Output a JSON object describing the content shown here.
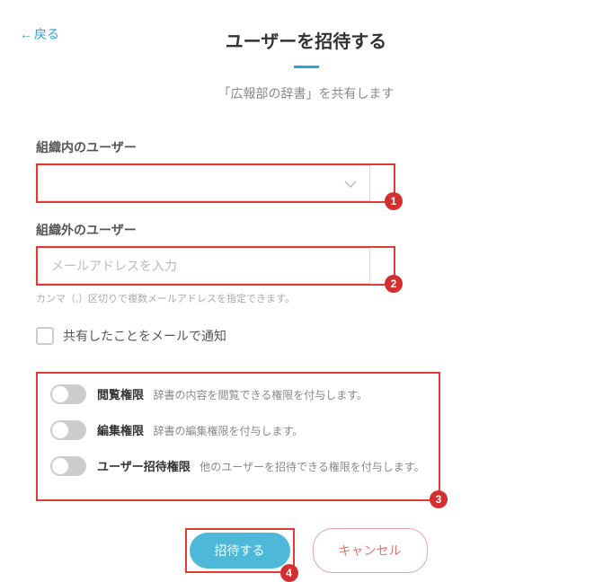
{
  "nav": {
    "back_label": "戻る"
  },
  "header": {
    "title": "ユーザーを招待する",
    "subtitle": "「広報部の辞書」を共有します"
  },
  "fields": {
    "internal": {
      "label": "組織内のユーザー"
    },
    "external": {
      "label": "組織外のユーザー",
      "placeholder": "メールアドレスを入力",
      "helper": "カンマ（,）区切りで複数メールアドレスを指定できます。"
    }
  },
  "notify": {
    "label": "共有したことをメールで通知"
  },
  "permissions": [
    {
      "name": "閲覧権限",
      "desc": "辞書の内容を閲覧できる権限を付与します。"
    },
    {
      "name": "編集権限",
      "desc": "辞書の編集権限を付与します。"
    },
    {
      "name": "ユーザー招待権限",
      "desc": "他のユーザーを招待できる権限を付与します。"
    }
  ],
  "buttons": {
    "invite": "招待する",
    "cancel": "キャンセル"
  },
  "annotations": {
    "b1": "1",
    "b2": "2",
    "b3": "3",
    "b4": "4"
  }
}
